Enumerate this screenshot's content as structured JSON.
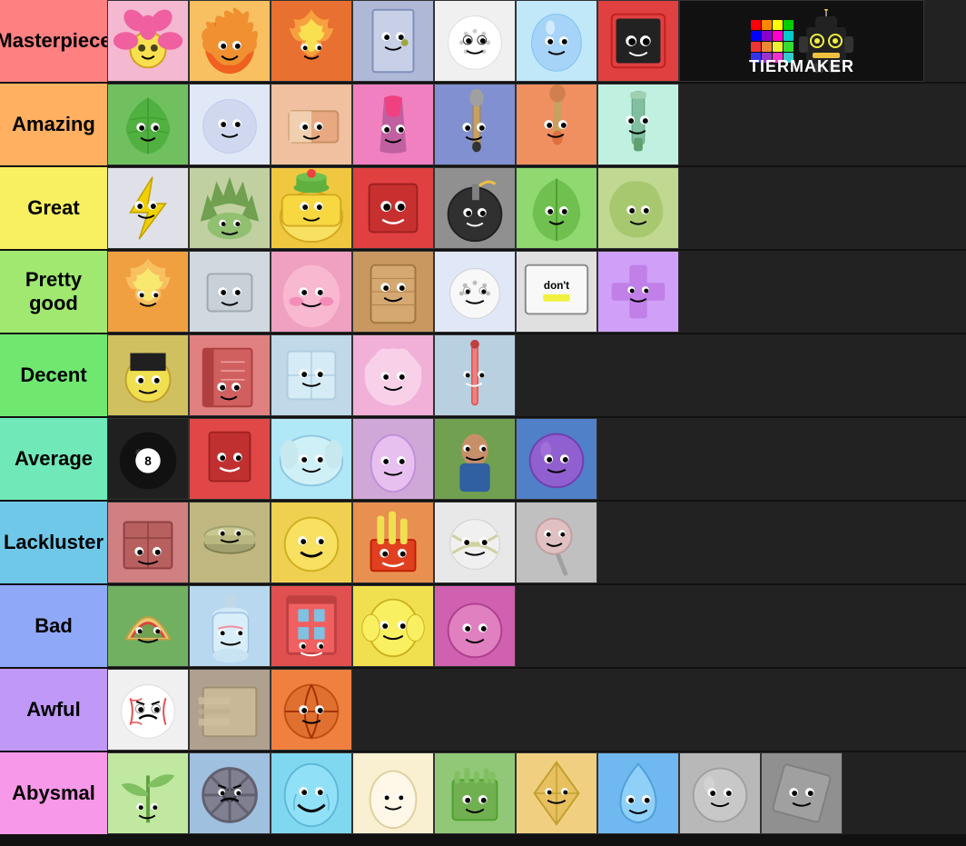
{
  "tiers": [
    {
      "id": "masterpiece",
      "label": "Masterpiece",
      "bgColor": "#ff8080",
      "cells": [
        {
          "name": "flower",
          "bg": "#f8b4d8",
          "emoji": "🌸"
        },
        {
          "name": "firey",
          "bg": "#f4a236",
          "emoji": "🔥"
        },
        {
          "name": "firey-alt",
          "bg": "#e87030",
          "emoji": "🔥"
        },
        {
          "name": "door",
          "bg": "#b0b8d8",
          "emoji": "🚪"
        },
        {
          "name": "golf-ball",
          "bg": "#f0f0f0",
          "emoji": "⚪"
        },
        {
          "name": "bubble",
          "bg": "#c0e8f8",
          "emoji": "🫧"
        },
        {
          "name": "tv",
          "bg": "#e04040",
          "emoji": "📺"
        },
        {
          "name": "logo",
          "bg": "#111",
          "special": "logo"
        }
      ]
    },
    {
      "id": "amazing",
      "label": "Amazing",
      "bgColor": "#ffb060",
      "cells": [
        {
          "name": "leafy",
          "bg": "#70c060",
          "emoji": "🍃"
        },
        {
          "name": "snowball",
          "bg": "#e0e8f8",
          "emoji": "❄"
        },
        {
          "name": "eraser",
          "bg": "#f0c0a0",
          "emoji": "📎"
        },
        {
          "name": "match",
          "bg": "#f080c0",
          "emoji": "🔮"
        },
        {
          "name": "paintbrush",
          "bg": "#8090d0",
          "emoji": "🎨"
        },
        {
          "name": "paintbrush2",
          "bg": "#f09060",
          "emoji": "🖌"
        },
        {
          "name": "marker",
          "bg": "#c0f0e0",
          "emoji": "✏"
        }
      ]
    },
    {
      "id": "great",
      "label": "Great",
      "bgColor": "#f8f060",
      "cells": [
        {
          "name": "lightning",
          "bg": "#e0e0e8",
          "emoji": "⚡"
        },
        {
          "name": "spike",
          "bg": "#c0d0a0",
          "emoji": "🌿"
        },
        {
          "name": "gelatin",
          "bg": "#f0c840",
          "emoji": "🟡"
        },
        {
          "name": "blocky",
          "bg": "#e04040",
          "emoji": "🟥"
        },
        {
          "name": "bomby",
          "bg": "#909090",
          "emoji": "💣"
        },
        {
          "name": "leafy2",
          "bg": "#90d870",
          "emoji": "🍀"
        },
        {
          "name": "blob",
          "bg": "#c0d890",
          "emoji": "🫙"
        }
      ]
    },
    {
      "id": "prettygood",
      "label": "Pretty good",
      "bgColor": "#a0e870",
      "cells": [
        {
          "name": "firey-jr",
          "bg": "#f0a040",
          "emoji": "🔥"
        },
        {
          "name": "coiny-alt",
          "bg": "#d0d8e0",
          "emoji": "🪙"
        },
        {
          "name": "loser",
          "bg": "#f0a0c0",
          "emoji": "💖"
        },
        {
          "name": "woody",
          "bg": "#c89860",
          "emoji": "🪵"
        },
        {
          "name": "golfball2",
          "bg": "#e0e8f8",
          "emoji": "⚪"
        },
        {
          "name": "donoteat",
          "bg": "#e0e0e0",
          "emoji": "🚫"
        },
        {
          "name": "purple-cross",
          "bg": "#d0a0f8",
          "emoji": "✚"
        }
      ]
    },
    {
      "id": "decent",
      "label": "Decent",
      "bgColor": "#70e870",
      "cells": [
        {
          "name": "black-hat",
          "bg": "#d0c060",
          "emoji": "🎩"
        },
        {
          "name": "book",
          "bg": "#e08080",
          "emoji": "📖"
        },
        {
          "name": "ice-cube",
          "bg": "#c0d8e8",
          "emoji": "🧊"
        },
        {
          "name": "puffball",
          "bg": "#f0b0d8",
          "emoji": "🌸"
        },
        {
          "name": "needle",
          "bg": "#b8d0e0",
          "emoji": "🪡"
        }
      ]
    },
    {
      "id": "average",
      "label": "Average",
      "bgColor": "#70e8b8",
      "cells": [
        {
          "name": "8ball",
          "bg": "#202020",
          "emoji": "🎱"
        },
        {
          "name": "fries",
          "bg": "#e04848",
          "emoji": "🍟"
        },
        {
          "name": "pillow",
          "bg": "#b0e8f8",
          "emoji": "🛏"
        },
        {
          "name": "eggy",
          "bg": "#d0a8d8",
          "emoji": "🥚"
        },
        {
          "name": "bracelety",
          "bg": "#70a050",
          "emoji": "👦"
        },
        {
          "name": "purple-ball",
          "bg": "#5080c8",
          "emoji": "🔵"
        }
      ]
    },
    {
      "id": "lackluster",
      "label": "Lackluster",
      "bgColor": "#70c8e8",
      "cells": [
        {
          "name": "box",
          "bg": "#d08080",
          "emoji": "📦"
        },
        {
          "name": "nickel",
          "bg": "#c0b880",
          "emoji": "🪙"
        },
        {
          "name": "yellow-face",
          "bg": "#f0d050",
          "emoji": "😃"
        },
        {
          "name": "fries2",
          "bg": "#e89050",
          "emoji": "🍟"
        },
        {
          "name": "tennis-ball",
          "bg": "#e8e8e8",
          "emoji": "🎾"
        },
        {
          "name": "lollipop",
          "bg": "#c0c0c0",
          "emoji": "🍭"
        }
      ]
    },
    {
      "id": "bad",
      "label": "Bad",
      "bgColor": "#90a8f8",
      "cells": [
        {
          "name": "taco",
          "bg": "#70b060",
          "emoji": "🌮"
        },
        {
          "name": "bottle",
          "bg": "#b8d8f0",
          "emoji": "🍶"
        },
        {
          "name": "window",
          "bg": "#e05050",
          "emoji": "🪟"
        },
        {
          "name": "lemon",
          "bg": "#f0e050",
          "emoji": "🍋"
        },
        {
          "name": "stapy",
          "bg": "#d060b0",
          "emoji": "📎"
        }
      ]
    },
    {
      "id": "awful",
      "label": "Awful",
      "bgColor": "#c098f8",
      "cells": [
        {
          "name": "baseball",
          "bg": "#f0f0f0",
          "emoji": "⚾"
        },
        {
          "name": "blurry",
          "bg": "#b0a090",
          "emoji": "💨"
        },
        {
          "name": "basketball",
          "bg": "#f08040",
          "emoji": "🏀"
        }
      ]
    },
    {
      "id": "abysmal",
      "label": "Abysmal",
      "bgColor": "#f898e8",
      "cells": [
        {
          "name": "sprout",
          "bg": "#c0e8a0",
          "emoji": "🌱"
        },
        {
          "name": "wheel",
          "bg": "#a0c0e0",
          "emoji": "⚙"
        },
        {
          "name": "happy-face",
          "bg": "#80d8f0",
          "emoji": "😊"
        },
        {
          "name": "eggy2",
          "bg": "#f8f0d0",
          "emoji": "🥚"
        },
        {
          "name": "grassy",
          "bg": "#90c878",
          "emoji": "🌿"
        },
        {
          "name": "kite",
          "bg": "#f0d080",
          "emoji": "🪁"
        },
        {
          "name": "teardrop",
          "bg": "#70b8f0",
          "emoji": "💧"
        },
        {
          "name": "grey-ball",
          "bg": "#b8b8b8",
          "emoji": "⚫"
        },
        {
          "name": "grey-square",
          "bg": "#909090",
          "emoji": "▪"
        }
      ]
    }
  ],
  "logo": {
    "text": "TIERMAKER",
    "gridColors": [
      "#ff0000",
      "#ff8800",
      "#ffff00",
      "#00ff00",
      "#0000ff",
      "#8800ff",
      "#ff00ff",
      "#00ffff",
      "#ff4444",
      "#ff9944",
      "#ffff44",
      "#44ff44",
      "#4444ff",
      "#aa44ff",
      "#ff44ff",
      "#44ffff"
    ]
  }
}
